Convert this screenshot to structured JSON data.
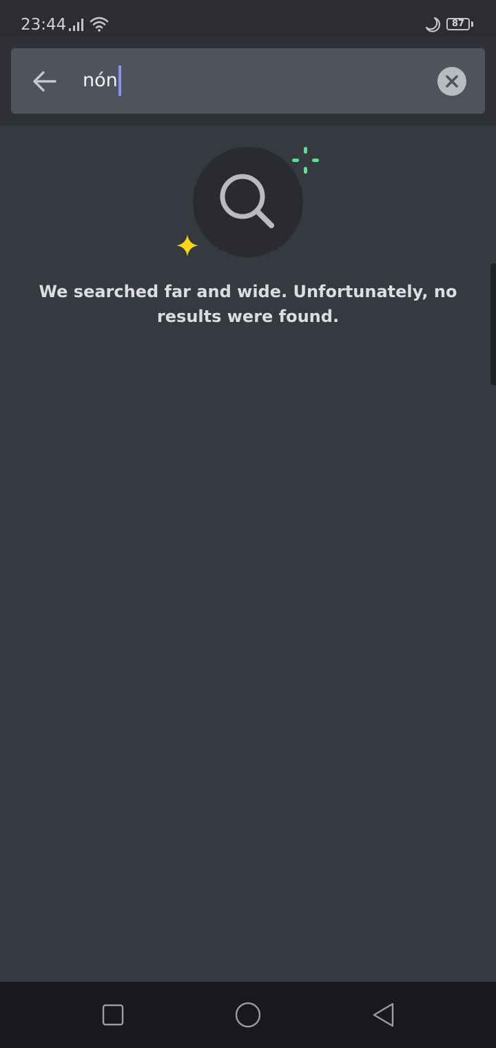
{
  "status_bar": {
    "time": "23:44",
    "battery": "87",
    "icons": [
      "signal-icon",
      "wifi-icon",
      "moon-icon",
      "battery-icon"
    ]
  },
  "search": {
    "query": "nón",
    "icons": {
      "back": "arrow-left-icon",
      "clear": "close-circle-icon"
    }
  },
  "empty_state": {
    "message": "We searched far and wide. Unfortunately, no results were found.",
    "icons": [
      "magnifier-icon",
      "sparkle-icon",
      "spark-burst-icon"
    ]
  },
  "nav_bar": {
    "icons": [
      "recents-square-icon",
      "home-circle-icon",
      "back-triangle-icon"
    ]
  },
  "colors": {
    "background": "#36393f",
    "header": "#2f3136",
    "search_field": "#4f545c",
    "caret": "#8b8ff0",
    "sparkle_yellow": "#fcd61a",
    "sparkle_green": "#57e38f"
  }
}
